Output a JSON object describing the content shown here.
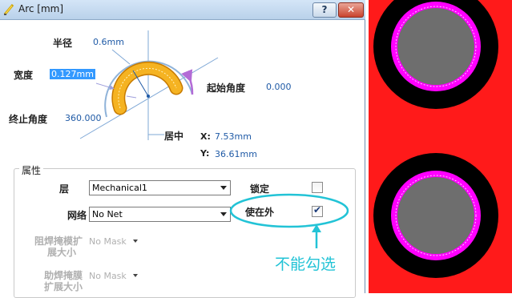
{
  "window": {
    "title": "Arc [mm]",
    "help_label": "?",
    "close_label": "✕"
  },
  "geometry": {
    "radius_label": "半径",
    "radius_value": "0.6mm",
    "width_label": "宽度",
    "width_value": "0.127mm",
    "start_angle_label": "起始角度",
    "start_angle_value": "0.000",
    "end_angle_label": "终止角度",
    "end_angle_value": "360.000",
    "center_label": "居中",
    "x_label": "X:",
    "x_value": "7.53mm",
    "y_label": "Y:",
    "y_value": "36.61mm"
  },
  "properties": {
    "group_title": "属性",
    "layer_label": "层",
    "layer_value": "Mechanical1",
    "net_label": "网络",
    "net_value": "No Net",
    "locked_label": "锁定",
    "locked_checked": false,
    "keepout_label": "使在外",
    "keepout_checked": true,
    "solder_mask_label_1": "阻焊掩模扩",
    "solder_mask_label_2": "展大小",
    "solder_mask_value": "No Mask",
    "paste_mask_label_1": "助焊掩膜",
    "paste_mask_label_2": "扩展大小",
    "paste_mask_value": "No Mask"
  },
  "annotation": {
    "text": "不能勾选",
    "color": "#22c3d6"
  },
  "colors": {
    "pcb_red": "#ff1a1a",
    "pad_black": "#000000",
    "pad_magenta": "#ff00ff",
    "hole_gray": "#6e6e6e",
    "accent_blue": "#1f5aa6"
  }
}
